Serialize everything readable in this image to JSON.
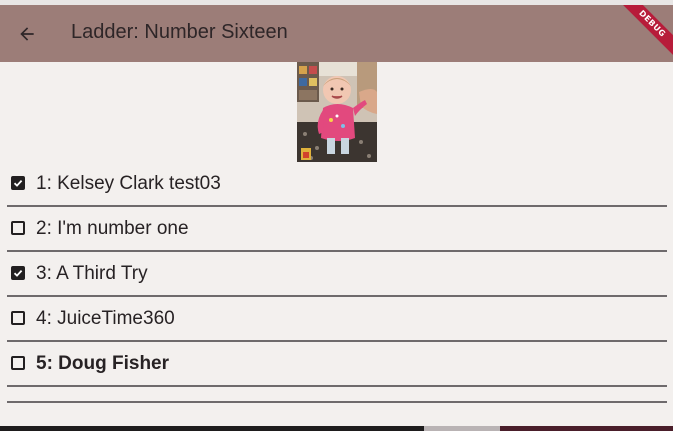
{
  "appbar": {
    "title": "Ladder: Number Sixteen",
    "back_icon": "arrow-back-icon",
    "background_color": "#9c7d78"
  },
  "debug_banner": {
    "label": "DEBUG",
    "color": "#b71c3a"
  },
  "photo": {
    "description_icon": "player-photo"
  },
  "players": [
    {
      "label": "1: Kelsey Clark test03",
      "checked": true,
      "bold": false
    },
    {
      "label": "2: I'm number one",
      "checked": false,
      "bold": false
    },
    {
      "label": "3: A Third Try",
      "checked": true,
      "bold": false
    },
    {
      "label": "4: JuiceTime360",
      "checked": false,
      "bold": false
    },
    {
      "label": "5: Doug Fisher",
      "checked": false,
      "bold": true
    }
  ],
  "colors": {
    "page_background": "#f3f0ee",
    "divider": "#6e6a6c",
    "checkbox": "#221f20"
  }
}
